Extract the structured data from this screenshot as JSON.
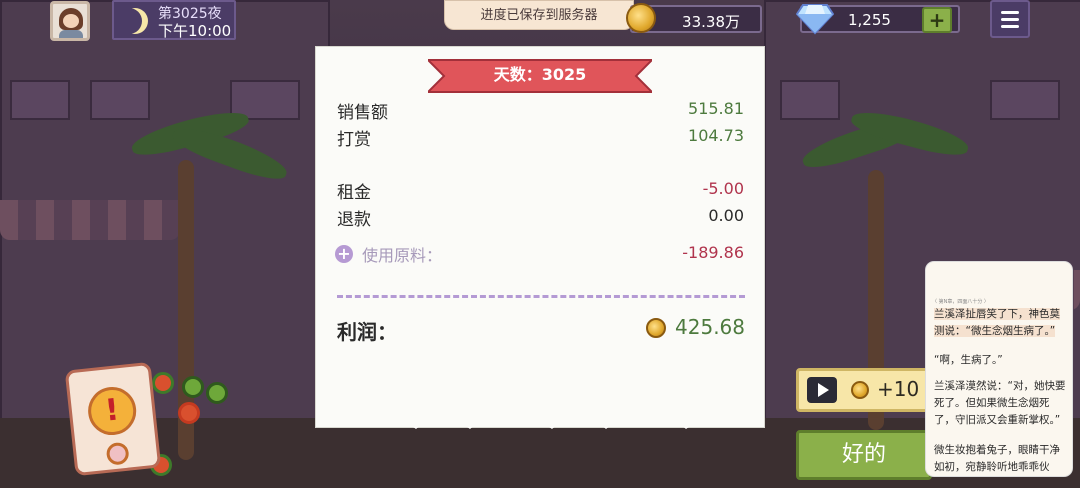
{
  "hud": {
    "night_label": "第3025夜",
    "time_label": "下午10:00",
    "save_toast": "进度已保存到服务器",
    "coins": "33.38万",
    "gems": "1,255",
    "gem_plus": "+"
  },
  "receipt": {
    "day_banner": "天数：3025",
    "rows": [
      {
        "label": "销售额",
        "value": "515.81"
      },
      {
        "label": "打赏",
        "value": "104.73"
      },
      {
        "label": "租金",
        "value": "-5.00"
      },
      {
        "label": "退款",
        "value": "0.00"
      }
    ],
    "materials_plus": "+",
    "materials_label": "使用原料：",
    "materials_value": "-189.86",
    "profit_label": "利润：",
    "profit_value": "425.68"
  },
  "alert": {
    "symbol": "!"
  },
  "actions": {
    "ad_reward": "+10",
    "ok_label": "好的"
  },
  "reader": {
    "header_left": "〈 第N章，四面八十分 〉",
    "header_right": "",
    "paragraphs": [
      "兰溪泽扯唇笑了下，神色莫测说：“微生念烟生病了。”",
      "“啊，生病了。”",
      "兰溪泽漠然说：“对，她快要死了。但如果微生念烟死了，守旧派又会重新掌权。”",
      "微生妆抱着兔子，眼睛干净如初，宛静聆听地乖乖伙"
    ]
  },
  "colors": {
    "positive": "#4d7a3e",
    "negative": "#b0344d",
    "banner": "#e0555a",
    "ok_button": "#8bb04a",
    "hud_panel": "#4b3c66"
  },
  "icons": [
    "moon-icon",
    "coin-icon",
    "diamond-icon",
    "menu-icon",
    "play-icon",
    "plus-icon",
    "alert-icon"
  ]
}
